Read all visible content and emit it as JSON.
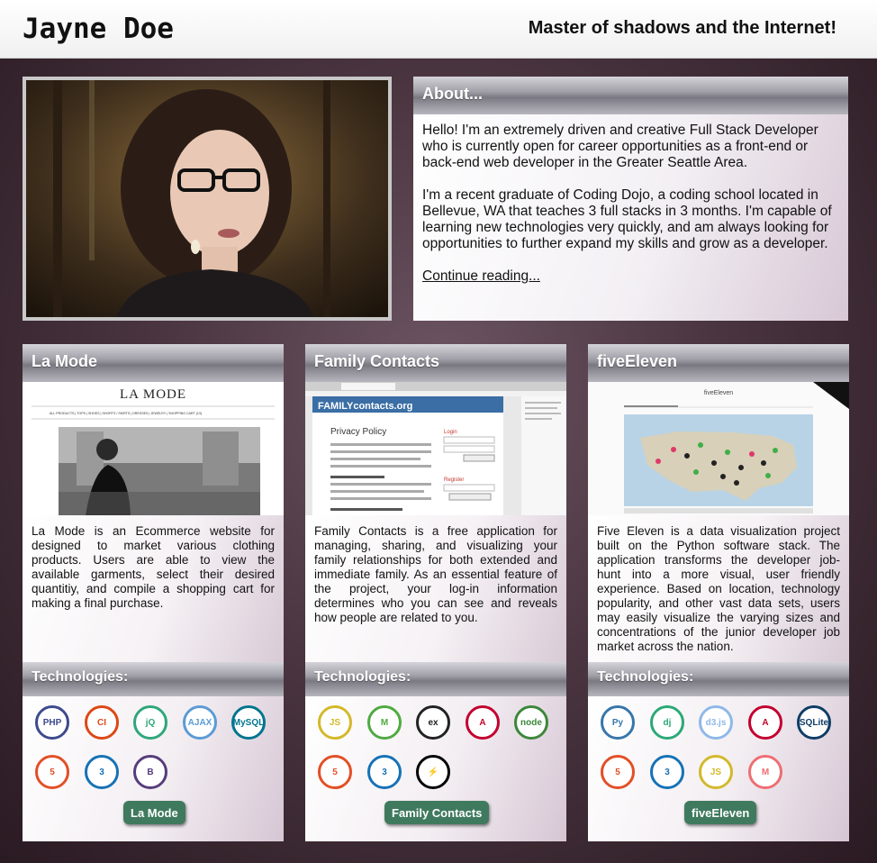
{
  "header": {
    "name": "Jayne Doe",
    "tagline": "Master of shadows and the Internet!"
  },
  "about": {
    "title": "About...",
    "paragraph1": "Hello! I'm an extremely driven and creative Full Stack Developer who is currently open for career opportunities as a front-end or back-end web developer in the Greater Seattle Area.",
    "paragraph2": "I'm a recent graduate of Coding Dojo, a coding school located in Bellevue, WA that teaches 3 full stacks in 3 months. I'm capable of learning new technologies very quickly, and am always looking for opportunities to further expand my skills and grow as a developer.",
    "link": "Continue reading..."
  },
  "projects": [
    {
      "title": "La Mode",
      "description": "La Mode is an Ecommerce website for designed to market various clothing products. Users are able to view the available garments, select their desired quantitiy, and compile a shopping cart for making a final purchase.",
      "tech_title": "Technologies:",
      "button": "La Mode",
      "screenshot": {
        "brand": "LA MODE",
        "nav": "ALL PRODUCTS | TOPS | SHOES | SHORTS / SKIRTS | DRESSES | JEWELRY | SHOPPING CART (13)"
      },
      "icons": [
        {
          "name": "php",
          "text": "PHP",
          "color": "#3d4a8c"
        },
        {
          "name": "codeigniter",
          "text": "CI",
          "color": "#dd4814"
        },
        {
          "name": "jquery",
          "text": "jQ",
          "color": "#2fa77a"
        },
        {
          "name": "ajax",
          "text": "AJAX",
          "color": "#5b9bd5"
        },
        {
          "name": "mysql",
          "text": "MySQL",
          "color": "#00758f"
        },
        {
          "name": "html5",
          "text": "5",
          "color": "#e34f26"
        },
        {
          "name": "css3",
          "text": "3",
          "color": "#1572b6"
        },
        {
          "name": "bootstrap",
          "text": "B",
          "color": "#563d7c"
        }
      ]
    },
    {
      "title": "Family Contacts",
      "description": "Family Contacts is a free application for managing, sharing, and visualizing your family relationships for both extended and immediate family. As an essential feature of the project, your log-in information determines who you can see and reveals how people are related to you.",
      "tech_title": "Technologies:",
      "button": "Family Contacts",
      "screenshot": {
        "brand": "FAMILYcontacts.org",
        "heading": "Privacy Policy",
        "login": "Login",
        "register": "Register"
      },
      "icons": [
        {
          "name": "javascript",
          "text": "JS",
          "color": "#d4b82a"
        },
        {
          "name": "mongodb",
          "text": "M",
          "color": "#4faa41"
        },
        {
          "name": "express",
          "text": "ex",
          "color": "#222222"
        },
        {
          "name": "angular",
          "text": "A",
          "color": "#c3002f"
        },
        {
          "name": "node",
          "text": "node",
          "color": "#3c873a"
        },
        {
          "name": "html5",
          "text": "5",
          "color": "#e34f26"
        },
        {
          "name": "css3",
          "text": "3",
          "color": "#1572b6"
        },
        {
          "name": "socketio",
          "text": "⚡",
          "color": "#000000"
        }
      ]
    },
    {
      "title": "fiveEleven",
      "description": "Five Eleven is a data visualization project built on the Python software stack. The application transforms the developer job-hunt into a more visual, user friendly experience. Based on location, technology popularity, and other vast data sets, users may easily visualize the varying sizes and concentrations of the junior developer job market across the nation.",
      "tech_title": "Technologies:",
      "button": "fiveEleven",
      "screenshot": {
        "brand": "fiveEleven"
      },
      "icons": [
        {
          "name": "python",
          "text": "Py",
          "color": "#3776ab"
        },
        {
          "name": "django",
          "text": "dj",
          "color": "#2ba977"
        },
        {
          "name": "d3",
          "text": "d3.js",
          "color": "#8fb8e8"
        },
        {
          "name": "angular",
          "text": "A",
          "color": "#c3002f"
        },
        {
          "name": "sqlite",
          "text": "SQLite",
          "color": "#0f3d66"
        },
        {
          "name": "html5",
          "text": "5",
          "color": "#e34f26"
        },
        {
          "name": "css3",
          "text": "3",
          "color": "#1572b6"
        },
        {
          "name": "javascript",
          "text": "JS",
          "color": "#d4b82a"
        },
        {
          "name": "materialize",
          "text": "M",
          "color": "#ee6e73"
        }
      ]
    }
  ]
}
